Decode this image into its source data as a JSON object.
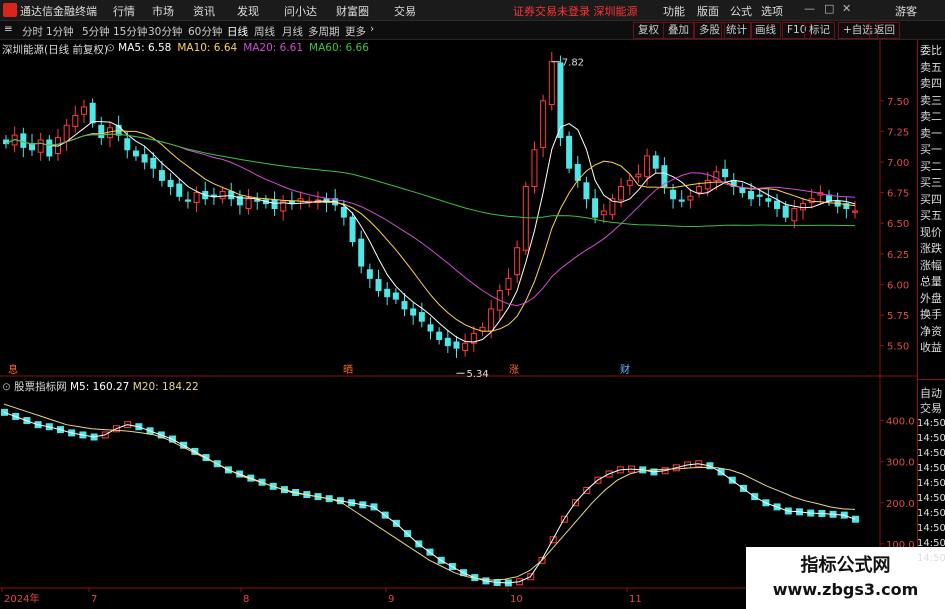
{
  "app": {
    "title": "通达信金融终端",
    "menu": [
      "行情",
      "市场",
      "资讯",
      "发现",
      "问小达",
      "财富圈",
      "交易"
    ],
    "notice": "证券交易未登录",
    "notice_link": "深圳能源",
    "right_menu": [
      "功能",
      "版面",
      "公式",
      "选项"
    ],
    "guest": "游客"
  },
  "periods": [
    "分时",
    "1分钟",
    "5分钟",
    "15分钟",
    "30分钟",
    "60分钟",
    "日线",
    "周线",
    "月线",
    "多周期",
    "更多"
  ],
  "active_period": "日线",
  "toolbar": [
    "复权",
    "叠加",
    "多股",
    "统计",
    "画线",
    "F10",
    "标记",
    "+自选",
    "返回"
  ],
  "main_panel": {
    "stock_label": "深圳能源(日线 前复权)",
    "ma": [
      {
        "label": "MA5: 6.58",
        "color": "#ffffff"
      },
      {
        "label": "MA10: 6.64",
        "color": "#ffd34d"
      },
      {
        "label": "MA20: 6.61",
        "color": "#d44bd4"
      },
      {
        "label": "MA60: 6.66",
        "color": "#3cc23c"
      }
    ],
    "high_label": "7.82",
    "low_label": "5.34",
    "markers": [
      {
        "text": "息",
        "x": 8
      },
      {
        "text": "晒",
        "x": 343
      },
      {
        "text": "涨",
        "x": 509
      },
      {
        "text": "财",
        "x": 620
      }
    ]
  },
  "sub_panel": {
    "title": "股票指标网",
    "m5": "M5: 160.27",
    "m20": "M20: 184.22"
  },
  "sidebar": [
    "委比",
    "卖五",
    "卖四",
    "卖三",
    "卖二",
    "卖一",
    "买一",
    "买二",
    "买三",
    "买四",
    "买五",
    "现价",
    "涨跌",
    "涨幅",
    "总量",
    "外盘",
    "换手",
    "净资",
    "收益"
  ],
  "sidebar_sub": [
    "自动",
    "交易",
    "14:50",
    "14:50",
    "14:50",
    "14:50",
    "14:50",
    "14:50",
    "14:50",
    "14:50",
    "14:50",
    "14:50"
  ],
  "x_axis": [
    "2024年",
    "7",
    "8",
    "9",
    "10",
    "11"
  ],
  "watermark": {
    "line1": "指标公式网",
    "line2": "www.zbgs3.com"
  },
  "colors": {
    "up": "#ff3b3b",
    "down": "#4ee6e6",
    "frame": "#8a1111",
    "ma5": "#ffffff",
    "ma10": "#ffd34d",
    "ma20": "#d44bd4",
    "ma60": "#3cc23c",
    "m20": "#e8d88a"
  },
  "chart_data": [
    {
      "type": "candlestick",
      "title": "深圳能源(日线 前复权)",
      "y_ticks": [
        7.5,
        7.25,
        7.0,
        6.75,
        6.5,
        6.25,
        6.0,
        5.75,
        5.5
      ],
      "ylim": [
        5.35,
        7.85
      ],
      "high": 7.82,
      "low": 5.34,
      "close": [
        7.15,
        7.22,
        7.12,
        7.1,
        7.18,
        7.05,
        7.2,
        7.3,
        7.38,
        7.45,
        7.32,
        7.2,
        7.28,
        7.22,
        7.1,
        7.05,
        7.0,
        6.95,
        6.85,
        6.8,
        6.72,
        6.68,
        6.75,
        6.7,
        6.72,
        6.76,
        6.7,
        6.65,
        6.7,
        6.68,
        6.66,
        6.62,
        6.68,
        6.66,
        6.7,
        6.68,
        6.69,
        6.67,
        6.65,
        6.55,
        6.35,
        6.15,
        6.05,
        5.95,
        5.9,
        5.88,
        5.8,
        5.75,
        5.7,
        5.62,
        5.55,
        5.5,
        5.48,
        5.52,
        5.6,
        5.65,
        5.8,
        5.95,
        6.05,
        6.3,
        6.8,
        7.1,
        7.5,
        7.82,
        7.2,
        6.95,
        6.85,
        6.7,
        6.55,
        6.6,
        6.7,
        6.8,
        6.85,
        6.9,
        7.05,
        6.95,
        6.8,
        6.7,
        6.68,
        6.72,
        6.8,
        6.85,
        6.92,
        6.88,
        6.8,
        6.75,
        6.7,
        6.72,
        6.68,
        6.62,
        6.55,
        6.62,
        6.66,
        6.7,
        6.75,
        6.68,
        6.64,
        6.62,
        6.6
      ],
      "series": [
        {
          "name": "MA5",
          "values_last": 6.58
        },
        {
          "name": "MA10",
          "values_last": 6.64
        },
        {
          "name": "MA20",
          "values_last": 6.61
        },
        {
          "name": "MA60",
          "values_last": 6.66
        }
      ]
    },
    {
      "type": "bar",
      "title": "股票指标网",
      "y_ticks": [
        400.0,
        300.0,
        200.0,
        100.0
      ],
      "ylim": [
        0,
        450
      ],
      "series": [
        {
          "name": "M5",
          "values": [
            420,
            410,
            400,
            390,
            385,
            378,
            370,
            365,
            360,
            365,
            380,
            390,
            385,
            375,
            365,
            355,
            340,
            325,
            310,
            295,
            280,
            270,
            260,
            250,
            240,
            232,
            225,
            220,
            215,
            210,
            205,
            200,
            195,
            190,
            170,
            150,
            125,
            100,
            80,
            60,
            45,
            30,
            18,
            10,
            6,
            5,
            8,
            20,
            60,
            110,
            160,
            200,
            230,
            255,
            270,
            280,
            282,
            280,
            275,
            278,
            285,
            292,
            295,
            290,
            275,
            255,
            235,
            215,
            200,
            190,
            180,
            178,
            175,
            174,
            172,
            170,
            160
          ]
        },
        {
          "name": "M20",
          "values": [
            440,
            430,
            420,
            410,
            400,
            390,
            385,
            380,
            378,
            376,
            374,
            370,
            365,
            355,
            340,
            325,
            310,
            295,
            280,
            265,
            255,
            245,
            235,
            225,
            220,
            215,
            210,
            200,
            180,
            160,
            140,
            120,
            100,
            80,
            60,
            45,
            30,
            20,
            15,
            12,
            14,
            20,
            35,
            60,
            95,
            130,
            165,
            200,
            230,
            255,
            270,
            278,
            280,
            282,
            283,
            285,
            286,
            285,
            280,
            270,
            255,
            240,
            228,
            215,
            205,
            198,
            190,
            185,
            184
          ]
        }
      ]
    }
  ]
}
